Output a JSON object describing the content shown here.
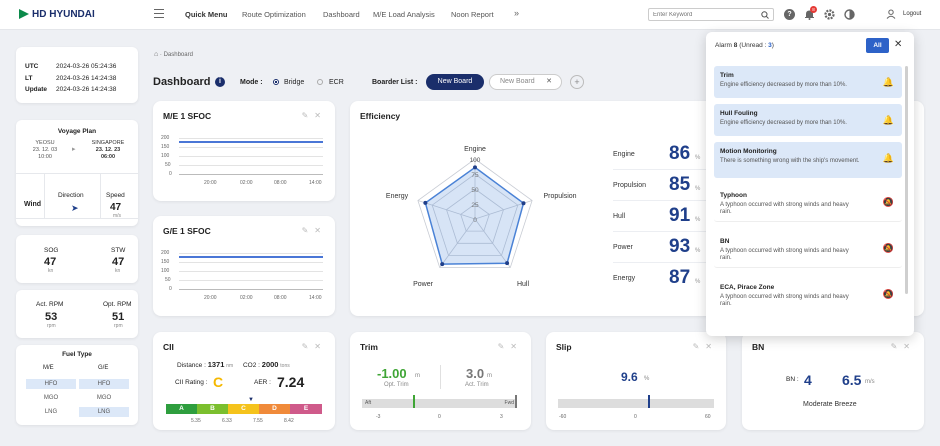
{
  "header": {
    "logo": "HD HYUNDAI",
    "menu": [
      "Quick Menu",
      "Route Optimization",
      "Dashboard",
      "M/E Load Analysis",
      "Noon Report"
    ],
    "more_icon": "double-chevron-right",
    "search_placeholder": "Enter Keyword",
    "notif_count": "8",
    "logout": "Logout"
  },
  "time": {
    "rows": [
      {
        "label": "UTC",
        "value": "2024-03-26 05:24:36"
      },
      {
        "label": "LT",
        "value": "2024-03-26 14:24:38"
      },
      {
        "label": "Update",
        "value": "2024-03-26 14:24:38"
      }
    ]
  },
  "voyage": {
    "title": "Voyage Plan",
    "from_port": "YEOSU",
    "from_date": "23. 12. 03",
    "from_time": "10:00",
    "to_port": "SINGAPORE",
    "to_date": "23. 12. 23",
    "to_time": "06:00"
  },
  "wind": {
    "label": "Wind",
    "direction_label": "Direction",
    "speed_label": "Speed",
    "speed": "47",
    "speed_unit": "m/s"
  },
  "speeds": {
    "sog_label": "SOG",
    "sog": "47",
    "stw_label": "STW",
    "stw": "47",
    "unit": "kn"
  },
  "rpm": {
    "act_label": "Act. RPM",
    "act": "53",
    "opt_label": "Opt. RPM",
    "opt": "51",
    "unit": "rpm"
  },
  "fuel": {
    "title": "Fuel Type",
    "me_label": "M/E",
    "ge_label": "G/E",
    "me": [
      "HFO",
      "MGO",
      "LNG"
    ],
    "ge": [
      "HFO",
      "MGO",
      "LNG"
    ]
  },
  "breadcrumb": {
    "home_icon": "home-icon",
    "page": "Dashboard"
  },
  "dashboard": {
    "title": "Dashboard",
    "mode_label": "Mode :",
    "modes": [
      "Bridge",
      "ECR"
    ],
    "board_list_label": "Boarder List :",
    "boards": [
      "New Board",
      "New Board"
    ]
  },
  "me_sfoc": {
    "title": "M/E 1 SFOC",
    "y_ticks": [
      "200",
      "150",
      "100",
      "50",
      "0"
    ],
    "x_ticks": [
      "20:00",
      "02:00",
      "08:00",
      "14:00"
    ]
  },
  "ge_sfoc": {
    "title": "G/E 1 SFOC",
    "y_ticks": [
      "200",
      "150",
      "100",
      "50",
      "0"
    ],
    "x_ticks": [
      "20:00",
      "02:00",
      "08:00",
      "14:00"
    ]
  },
  "efficiency": {
    "title": "Efficiency",
    "axes": [
      "Engine",
      "Propulsion",
      "Hull",
      "Power",
      "Energy"
    ],
    "radar_ticks": [
      "100",
      "75",
      "50",
      "25",
      "0"
    ],
    "items": [
      {
        "name": "Engine",
        "value": "86",
        "unit": "%"
      },
      {
        "name": "Propulsion",
        "value": "85",
        "unit": "%"
      },
      {
        "name": "Hull",
        "value": "91",
        "unit": "%"
      },
      {
        "name": "Power",
        "value": "93",
        "unit": "%"
      },
      {
        "name": "Energy",
        "value": "87",
        "unit": "%"
      }
    ],
    "chart_values": [
      86,
      85,
      91,
      93,
      87
    ]
  },
  "cii": {
    "title": "CII",
    "distance_label": "Distance :",
    "distance": "1371",
    "distance_unit": "nm",
    "co2_label": "CO2 :",
    "co2": "2000",
    "co2_unit": "tons",
    "rating_label": "CII Rating :",
    "rating": "C",
    "aer_label": "AER :",
    "aer": "7.24",
    "scale": [
      "A",
      "B",
      "C",
      "D",
      "E"
    ],
    "scale_colors": [
      "#2e9e3e",
      "#7bbf2e",
      "#f5c31c",
      "#f08a3a",
      "#cf5a8a"
    ],
    "thresholds": [
      "5.35",
      "6.33",
      "7.55",
      "8.42"
    ]
  },
  "trim": {
    "title": "Trim",
    "opt_value": "-1.00",
    "opt_unit": "m",
    "opt_label": "Opt. Trim",
    "act_value": "3.0",
    "act_unit": "m",
    "act_label": "Act. Trim",
    "aft": "Aft",
    "fwd": "Fwd",
    "ticks": [
      "-3",
      "0",
      "3"
    ],
    "opt_fraction": 0.33,
    "act_fraction": 1.0
  },
  "slip": {
    "title": "Slip",
    "value": "9.6",
    "unit": "%",
    "ticks": [
      "-60",
      "0",
      "60"
    ],
    "fraction": 0.58
  },
  "bn": {
    "title": "BN",
    "label": "BN :",
    "value": "4",
    "speed": "6.5",
    "speed_unit": "m/s",
    "desc": "Moderate Breeze"
  },
  "alarms": {
    "title": "Alarm",
    "count": "8",
    "unread_label": "(Unread :",
    "unread": "3",
    "unread_close": ")",
    "all_label": "All",
    "items": [
      {
        "title": "Trim",
        "desc": "Engine efficiency decreased by more than 10%.",
        "unread": true
      },
      {
        "title": "Hull Fouling",
        "desc": "Engine efficiency decreased by more than 10%.",
        "unread": true
      },
      {
        "title": "Motion Monitoring",
        "desc": "There is something wrong with the ship's movement.",
        "unread": true
      },
      {
        "title": "Typhoon",
        "desc": "A typhoon occurred with strong winds and heavy rain.",
        "unread": false
      },
      {
        "title": "BN",
        "desc": "A typhoon occurred with strong winds and heavy rain.",
        "unread": false
      },
      {
        "title": "ECA, Pirace Zone",
        "desc": "A typhoon occurred with strong winds and heavy rain.",
        "unread": false
      }
    ]
  }
}
